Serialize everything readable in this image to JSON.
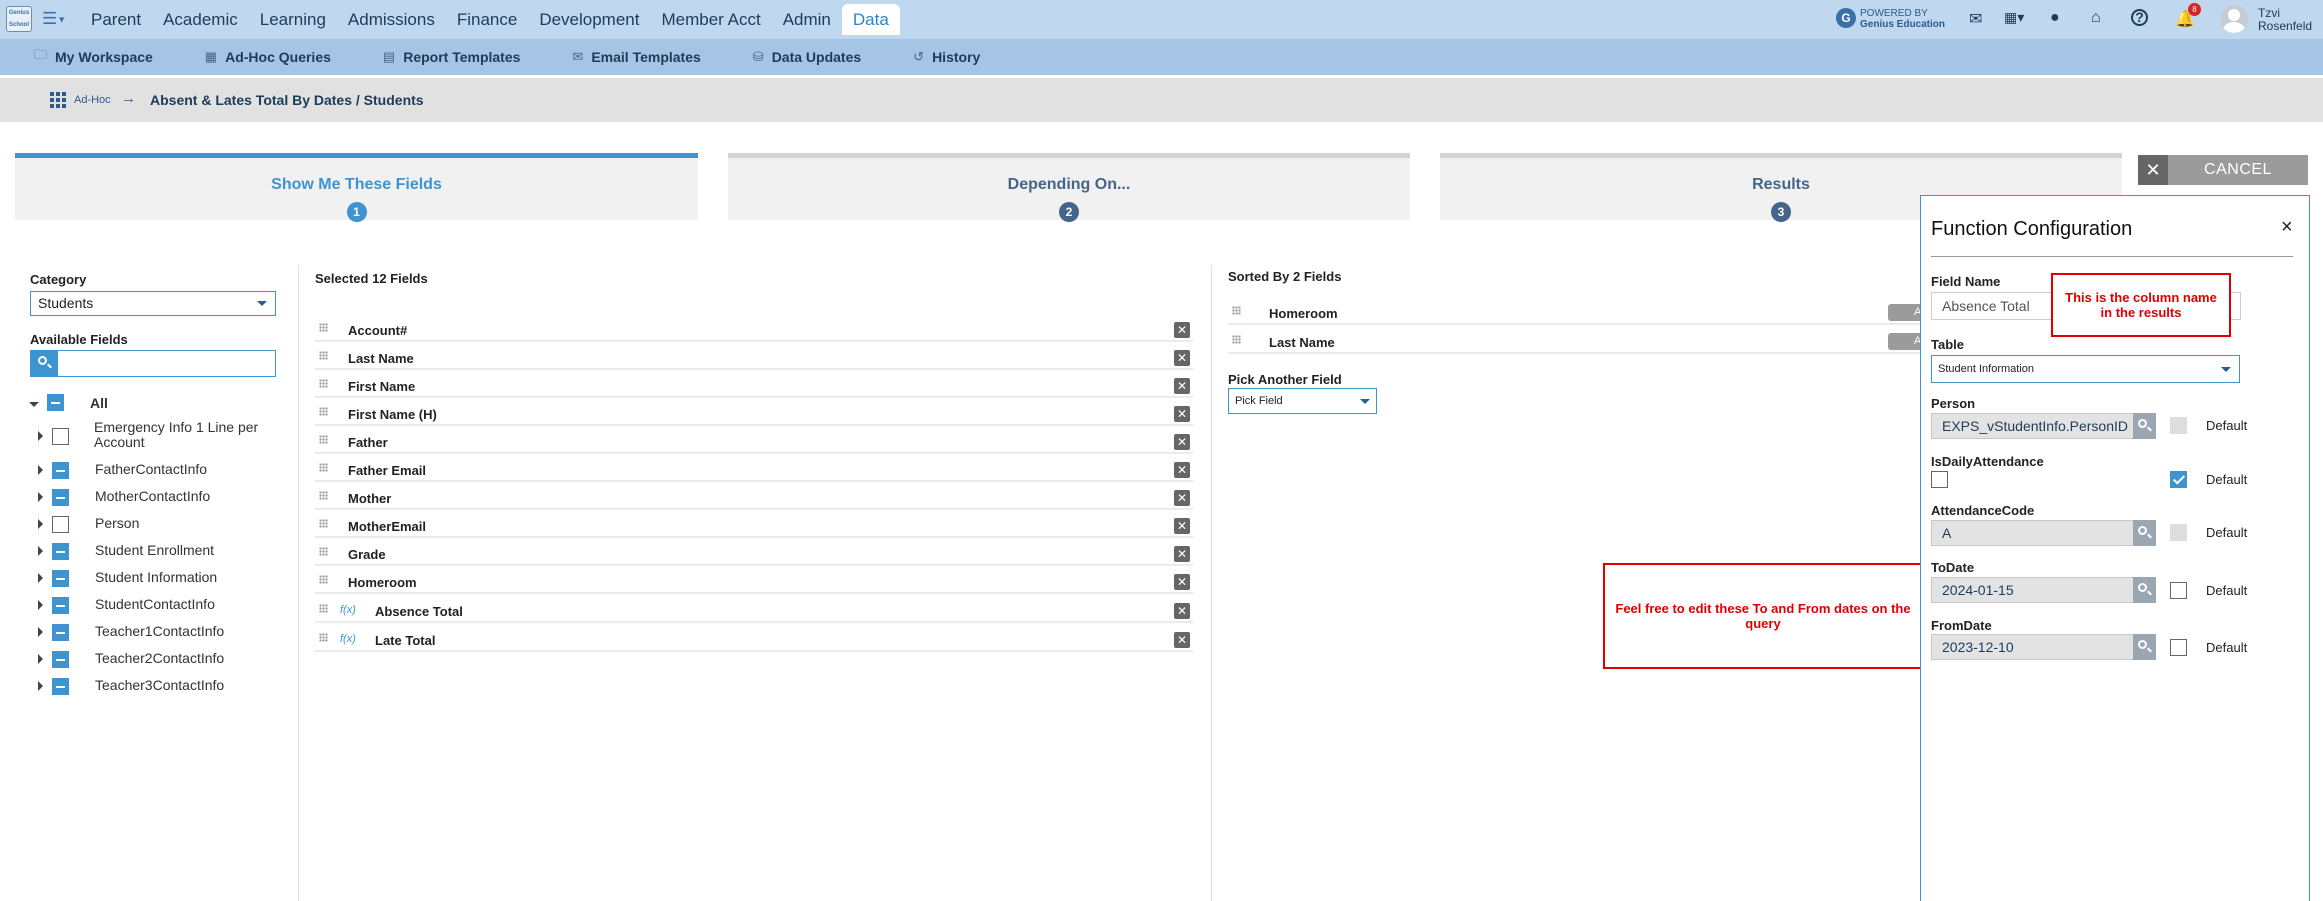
{
  "topnav": {
    "logo_text": "Genius School",
    "items": [
      "Parent",
      "Academic",
      "Learning",
      "Admissions",
      "Finance",
      "Development",
      "Member Acct",
      "Admin",
      "Data"
    ],
    "active": "Data",
    "powered_line1": "POWERED BY",
    "powered_line2": "Genius Education",
    "notifications_count": "8",
    "user_first": "Tzvi",
    "user_last": "Rosenfeld"
  },
  "subnav": [
    {
      "icon": "folder-icon",
      "label": "My Workspace"
    },
    {
      "icon": "table-icon",
      "label": "Ad-Hoc Queries"
    },
    {
      "icon": "document-icon",
      "label": "Report Templates"
    },
    {
      "icon": "email-template-icon",
      "label": "Email Templates"
    },
    {
      "icon": "database-icon",
      "label": "Data Updates"
    },
    {
      "icon": "history-icon",
      "label": "History"
    }
  ],
  "breadcrumb": {
    "root": "Ad-Hoc",
    "current": "Absent & Lates Total By Dates / Students"
  },
  "steps": [
    {
      "label": "Show Me These Fields",
      "num": "1"
    },
    {
      "label": "Depending On...",
      "num": "2"
    },
    {
      "label": "Results",
      "num": "3"
    }
  ],
  "cancel_label": "CANCEL",
  "left": {
    "category_label": "Category",
    "category_value": "Students",
    "available_label": "Available Fields",
    "search_value": "",
    "tree": [
      {
        "label": "All",
        "state": "partial"
      },
      {
        "label": "Emergency Info 1 Line per Account",
        "state": "none"
      },
      {
        "label": "FatherContactInfo",
        "state": "partial"
      },
      {
        "label": "MotherContactInfo",
        "state": "partial"
      },
      {
        "label": "Person",
        "state": "none"
      },
      {
        "label": "Student Enrollment",
        "state": "partial"
      },
      {
        "label": "Student Information",
        "state": "partial"
      },
      {
        "label": "StudentContactInfo",
        "state": "partial"
      },
      {
        "label": "Teacher1ContactInfo",
        "state": "partial"
      },
      {
        "label": "Teacher2ContactInfo",
        "state": "partial"
      },
      {
        "label": "Teacher3ContactInfo",
        "state": "partial"
      }
    ]
  },
  "selected": {
    "header": "Selected 12 Fields",
    "fields": [
      {
        "name": "Account#",
        "fx": false
      },
      {
        "name": "Last Name",
        "fx": false
      },
      {
        "name": "First Name",
        "fx": false
      },
      {
        "name": "First Name (H)",
        "fx": false
      },
      {
        "name": "Father",
        "fx": false
      },
      {
        "name": "Father Email",
        "fx": false
      },
      {
        "name": "Mother",
        "fx": false
      },
      {
        "name": "MotherEmail",
        "fx": false
      },
      {
        "name": "Grade",
        "fx": false
      },
      {
        "name": "Homeroom",
        "fx": false
      },
      {
        "name": "Absence Total",
        "fx": true
      },
      {
        "name": "Late Total",
        "fx": true
      }
    ],
    "fx_symbol": "f(x)"
  },
  "sorted": {
    "header": "Sorted By 2 Fields",
    "fields": [
      "Homeroom",
      "Last Name"
    ],
    "pill_label": "A",
    "pick_label": "Pick Another Field",
    "pick_value": "Pick Field"
  },
  "notes": {
    "column_name": "This is the column name in the results",
    "dates": "Feel free to edit these To and From dates on the query"
  },
  "panel": {
    "title": "Function Configuration",
    "close": "×",
    "field_name_label": "Field Name",
    "field_name_value": "Absence Total",
    "table_label": "Table",
    "table_value": "Student Information",
    "default_label": "Default",
    "params": [
      {
        "label": "Person",
        "value": "EXPS_vStudentInfo.PersonID",
        "type": "field",
        "default": "disabled"
      },
      {
        "label": "IsDailyAttendance",
        "value": "",
        "type": "checkbox",
        "default": "checked"
      },
      {
        "label": "AttendanceCode",
        "value": "A",
        "type": "field",
        "default": "disabled"
      },
      {
        "label": "ToDate",
        "value": "2024-01-15",
        "type": "field",
        "default": "none"
      },
      {
        "label": "FromDate",
        "value": "2023-12-10",
        "type": "field",
        "default": "none"
      }
    ]
  },
  "colors": {
    "accent": "#3d94d1",
    "nav_bg": "#bfd8ef",
    "subnav_bg": "#a6c4e3",
    "note_red": "#e00000"
  }
}
